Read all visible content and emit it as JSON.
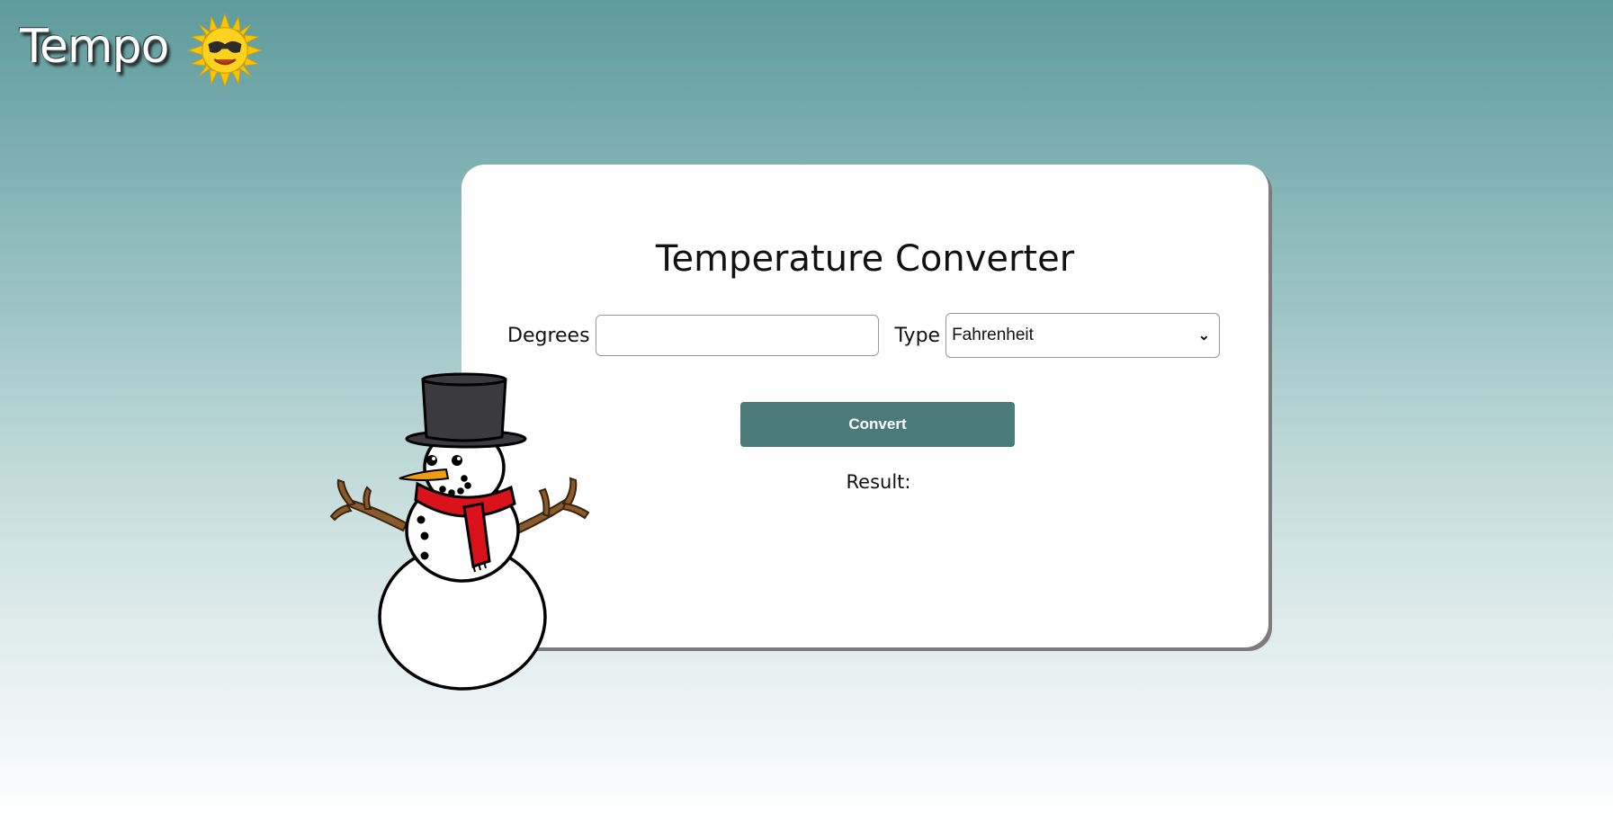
{
  "logo": {
    "text": "Tempo",
    "icon": "sun-with-sunglasses-icon"
  },
  "card": {
    "title": "Temperature Converter",
    "degrees_label": "Degrees",
    "degrees_value": "",
    "type_label": "Type",
    "type_selected": "Fahrenheit",
    "convert_label": "Convert",
    "result_label": "Result:"
  },
  "illustration": {
    "icon": "snowman-icon"
  },
  "colors": {
    "accent": "#4a7b7a",
    "background_top": "#5e9b9c",
    "background_bottom": "#ffffff",
    "scarf": "#d9121b",
    "sun": "#f7c600"
  }
}
